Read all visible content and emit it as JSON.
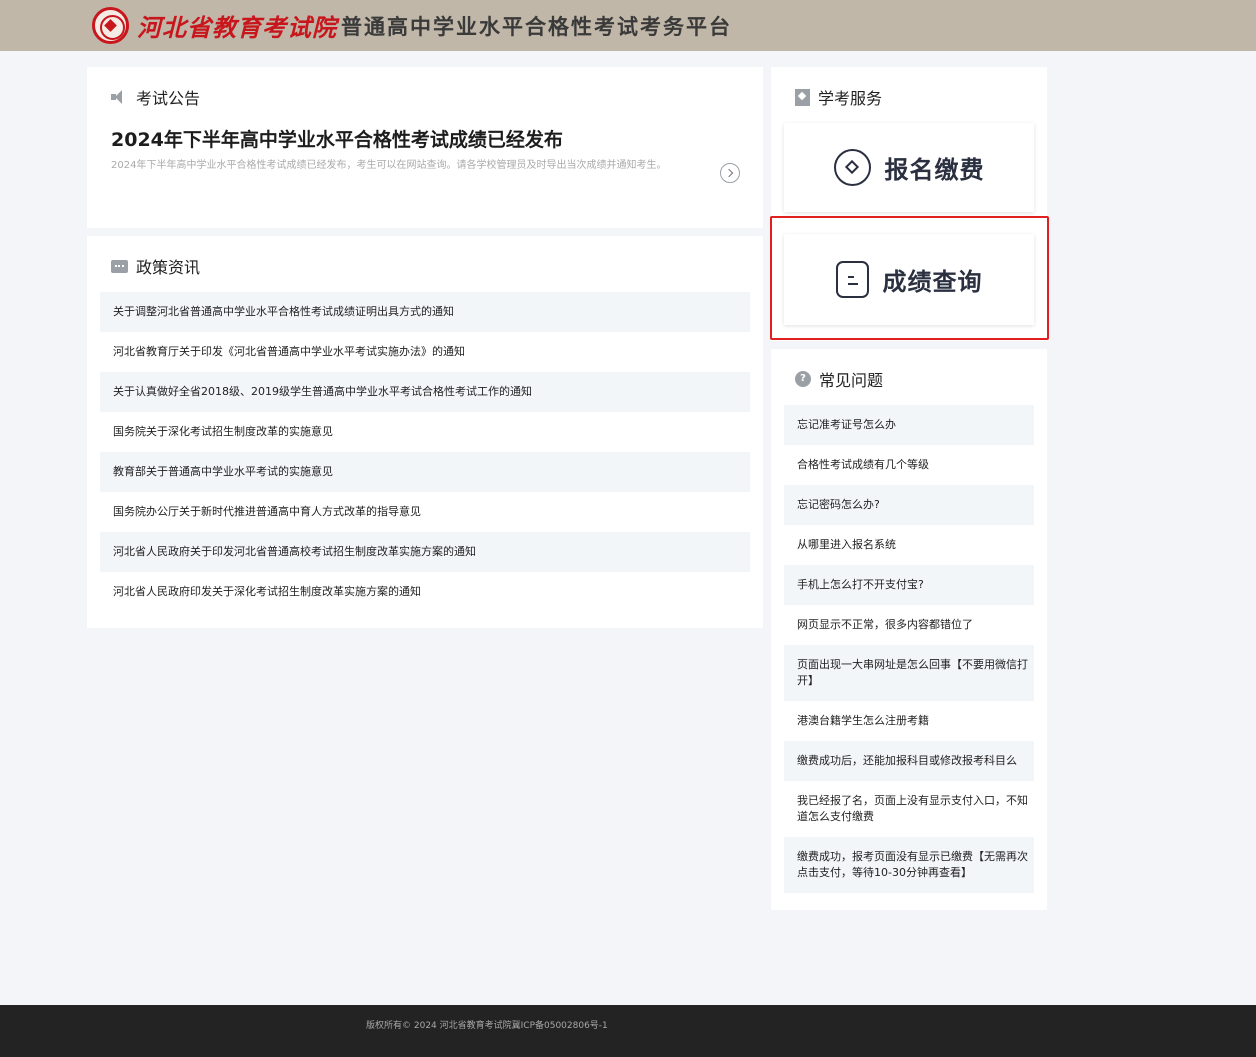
{
  "header": {
    "org_name": "河北省教育考试院",
    "platform_title": "普通高中学业水平合格性考试考务平台",
    "brand_color": "#c8161d",
    "bg_color": "#c0b7a8"
  },
  "notice": {
    "section_title": "考试公告",
    "icon": "speaker-icon",
    "headline": "2024年下半年高中学业水平合格性考试成绩已经发布",
    "description": "2024年下半年高中学业水平合格性考试成绩已经发布，考生可以在网站查询。请各学校管理员及时导出当次成绩并通知考生。",
    "arrow_icon": "chevron-right-circle-icon"
  },
  "policy": {
    "section_title": "政策资讯",
    "icon": "chat-icon",
    "items": [
      "关于调整河北省普通高中学业水平合格性考试成绩证明出具方式的通知",
      "河北省教育厅关于印发《河北省普通高中学业水平考试实施办法》的通知",
      "关于认真做好全省2018级、2019级学生普通高中学业水平考试合格性考试工作的通知",
      "国务院关于深化考试招生制度改革的实施意见",
      "教育部关于普通高中学业水平考试的实施意见",
      "国务院办公厅关于新时代推进普通高中育人方式改革的指导意见",
      "河北省人民政府关于印发河北省普通高校考试招生制度改革实施方案的通知",
      "河北省人民政府印发关于深化考试招生制度改革实施方案的通知"
    ]
  },
  "service": {
    "section_title": "学考服务",
    "icon": "bookmark-icon",
    "register_label": "报名缴费",
    "score_label": "成绩查询",
    "highlight_color": "#e02020"
  },
  "faq": {
    "section_title": "常见问题",
    "icon": "question-icon",
    "icon_glyph": "?",
    "items": [
      "忘记准考证号怎么办",
      "合格性考试成绩有几个等级",
      "忘记密码怎么办?",
      "从哪里进入报名系统",
      "手机上怎么打不开支付宝?",
      "网页显示不正常，很多内容都错位了",
      "页面出现一大串网址是怎么回事【不要用微信打开】",
      "港澳台籍学生怎么注册考籍",
      "缴费成功后，还能加报科目或修改报考科目么",
      "我已经报了名，页面上没有显示支付入口，不知道怎么支付缴费",
      "缴费成功，报考页面没有显示已缴费【无需再次点击支付，等待10-30分钟再查看】"
    ]
  },
  "footer": {
    "copyright": "版权所有© 2024 河北省教育考试院冀ICP备05002806号-1"
  }
}
